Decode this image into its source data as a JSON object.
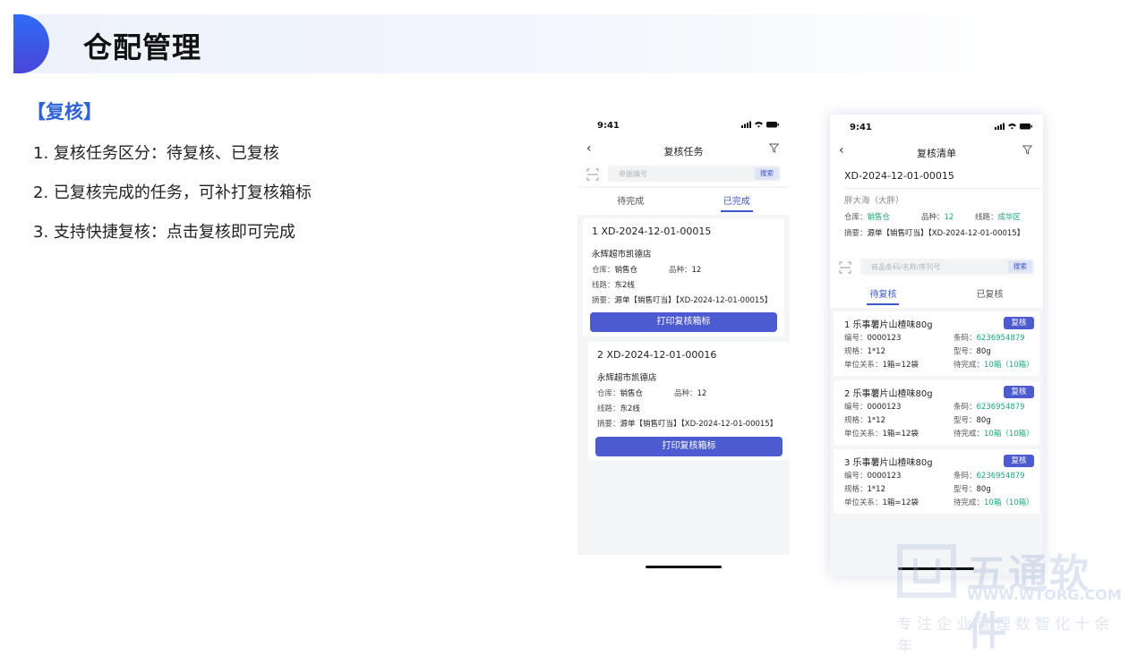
{
  "slide": {
    "title": "仓配管理",
    "section": "【复核】",
    "bullets": [
      "1. 复核任务区分：待复核、已复核",
      "2. 已复核完成的任务，可补打复核箱标",
      "3. 支持快捷复核：点击复核即可完成"
    ]
  },
  "phone1": {
    "time": "9:41",
    "back": "‹",
    "title": "复核任务",
    "search_placeholder": "单据编号",
    "search_button": "搜索",
    "tabs": [
      "待完成",
      "已完成"
    ],
    "active_tab": 1,
    "cards": [
      {
        "header": "1  XD-2024-12-01-00015",
        "store": "永辉超市凯德店",
        "warehouse_label": "仓库：",
        "warehouse": "销售仓",
        "variety_label": "品种：",
        "variety": "12",
        "route_label": "线路：",
        "route": "东2线",
        "summary_label": "摘要：",
        "summary": "源单【销售叮当】【XD-2024-12-01-00015】",
        "button": "打印复核箱标"
      },
      {
        "header": "2  XD-2024-12-01-00016",
        "store": "永辉超市凯德店",
        "warehouse_label": "仓库：",
        "warehouse": "销售仓",
        "variety_label": "品种：",
        "variety": "12",
        "route_label": "线路：",
        "route": "东2线",
        "summary_label": "摘要：",
        "summary": "源单【销售叮当】【XD-2024-12-01-00015】",
        "button": "打印复核箱标"
      }
    ]
  },
  "phone2": {
    "time": "9:41",
    "back": "‹",
    "title": "复核清单",
    "doc_no": "XD-2024-12-01-00015",
    "customer": "胖大海",
    "customer_alias": "（大胖）",
    "warehouse_label": "仓库：",
    "warehouse": "销售仓",
    "variety_label": "品种：",
    "variety": "12",
    "route_label": "线路：",
    "route": "成华区",
    "summary_label": "摘要：",
    "summary": "源单【销售叮当】【XD-2024-12-01-00015】",
    "search_placeholder": "商品条码/名称/序列号",
    "search_button": "搜索",
    "tabs": [
      "待复核",
      "已复核"
    ],
    "active_tab": 0,
    "items": [
      {
        "name": "1 乐事薯片山楂味80g",
        "button": "复核",
        "code_label": "编号：",
        "code": "0000123",
        "barcode_label": "条码：",
        "barcode": "6236954879",
        "spec_label": "规格：",
        "spec": "1*12",
        "model_label": "型号：",
        "model": "80g",
        "unit_label": "单位关系：",
        "unit": "1箱=12袋",
        "pending_label": "待完成：",
        "pending": "10箱（10箱）"
      },
      {
        "name": "2  乐事薯片山楂味80g",
        "button": "复核",
        "code_label": "编号：",
        "code": "0000123",
        "barcode_label": "条码：",
        "barcode": "6236954879",
        "spec_label": "规格：",
        "spec": "1*12",
        "model_label": "型号：",
        "model": "80g",
        "unit_label": "单位关系：",
        "unit": "1箱=12袋",
        "pending_label": "待完成：",
        "pending": "10箱（10箱）"
      },
      {
        "name": "3  乐事薯片山楂味80g",
        "button": "复核",
        "code_label": "编号：",
        "code": "0000123",
        "barcode_label": "条码：",
        "barcode": "6236954879",
        "spec_label": "规格：",
        "spec": "1*12",
        "model_label": "型号：",
        "model": "80g",
        "unit_label": "单位关系：",
        "unit": "1箱=12袋",
        "pending_label": "待完成：",
        "pending": "10箱（10箱）"
      }
    ]
  },
  "watermark": {
    "brand": "五通软件",
    "url": "WWW.WTORG.COM",
    "slogan": "专注企业管理数智化十余年"
  },
  "colors": {
    "accent": "#3f56d0",
    "button": "#4d5bd0",
    "green": "#1aa874",
    "section": "#2f62d8"
  }
}
